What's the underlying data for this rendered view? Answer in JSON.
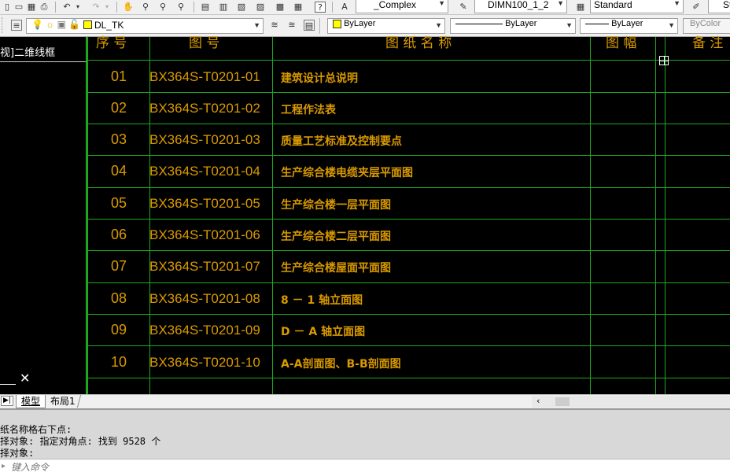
{
  "toolbar_top": {
    "text_style": "_Complex",
    "dim_style": "DIMN100_1_2",
    "table_style": "Standard",
    "trailing": "St"
  },
  "toolbar_layer": {
    "layer_name": "DL_TK",
    "color": "ByLayer",
    "linetype": "ByLayer",
    "lineweight": "ByLayer",
    "plotstyle": "ByColor"
  },
  "viewport_label": "视]二维线框",
  "table_header": {
    "col1": "序 号",
    "col2": "图 号",
    "col3": "图 纸 名 称",
    "col4": "图 幅",
    "col5": "备 注"
  },
  "rows": [
    {
      "no": "01",
      "code": "BX364S-T0201-01",
      "title": "建筑设计总说明"
    },
    {
      "no": "02",
      "code": "BX364S-T0201-02",
      "title": "工程作法表"
    },
    {
      "no": "03",
      "code": "BX364S-T0201-03",
      "title": "质量工艺标准及控制要点"
    },
    {
      "no": "04",
      "code": "BX364S-T0201-04",
      "title": "生产综合楼电缆夹层平面图"
    },
    {
      "no": "05",
      "code": "BX364S-T0201-05",
      "title": "生产综合楼一层平面图"
    },
    {
      "no": "06",
      "code": "BX364S-T0201-06",
      "title": "生产综合楼二层平面图"
    },
    {
      "no": "07",
      "code": "BX364S-T0201-07",
      "title": "生产综合楼屋面平面图"
    },
    {
      "no": "08",
      "code": "BX364S-T0201-08",
      "title": "8 －  1 轴立面图"
    },
    {
      "no": "09",
      "code": "BX364S-T0201-09",
      "title": "D －  A 轴立面图"
    },
    {
      "no": "10",
      "code": "BX364S-T0201-10",
      "title": "A-A剖面图、B-B剖面图"
    }
  ],
  "tabs": {
    "model": "模型",
    "layout1": "布局1"
  },
  "command_history": [
    "纸名称格右下点:",
    "择对象: 指定对角点: 找到 9528 个",
    "择对象:"
  ],
  "command_input": {
    "placeholder": "键入命令"
  }
}
